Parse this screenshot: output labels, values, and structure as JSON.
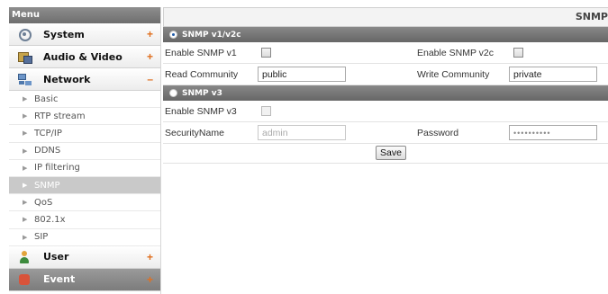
{
  "menu": {
    "title": "Menu",
    "categories": [
      {
        "label": "System",
        "toggle": "+",
        "icon": "gear-icon"
      },
      {
        "label": "Audio & Video",
        "toggle": "+",
        "icon": "audio-video-icon"
      },
      {
        "label": "Network",
        "toggle": "–",
        "icon": "network-icon"
      },
      {
        "label": "User",
        "toggle": "+",
        "icon": "user-icon"
      },
      {
        "label": "Event",
        "toggle": "+",
        "icon": "event-icon"
      }
    ],
    "network_items": [
      "Basic",
      "RTP stream",
      "TCP/IP",
      "DDNS",
      "IP filtering",
      "SNMP",
      "QoS",
      "802.1x",
      "SIP"
    ],
    "active_item": "SNMP"
  },
  "page": {
    "title": "SNMP"
  },
  "snmp_v1v2c": {
    "section_label": "SNMP v1/v2c",
    "enable_v1_label": "Enable SNMP v1",
    "enable_v2c_label": "Enable SNMP v2c",
    "read_community_label": "Read Community",
    "read_community_value": "public",
    "write_community_label": "Write Community",
    "write_community_value": "private"
  },
  "snmp_v3": {
    "section_label": "SNMP v3",
    "enable_v3_label": "Enable SNMP v3",
    "security_name_label": "SecurityName",
    "security_name_value": "admin",
    "password_label": "Password",
    "password_value": "••••••••••"
  },
  "actions": {
    "save_label": "Save"
  }
}
